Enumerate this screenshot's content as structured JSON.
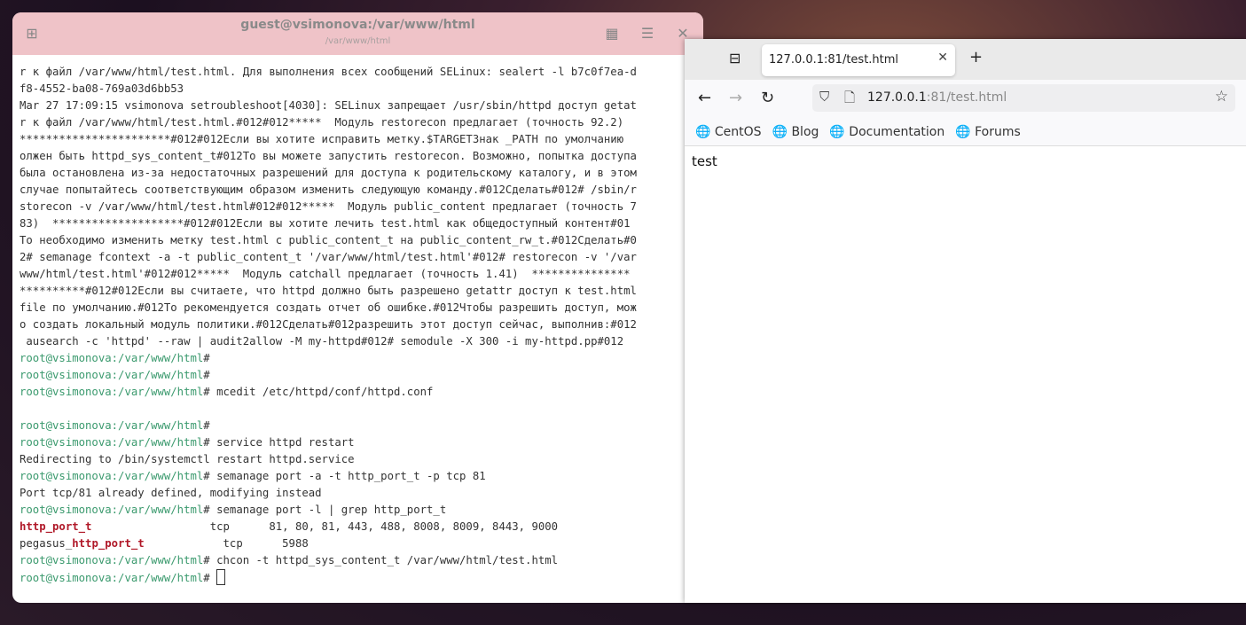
{
  "terminal": {
    "title": "guest@vsimonova:/var/www/html",
    "subtitle": "/var/www/html",
    "lines": [
      {
        "text": "r к файл /var/www/html/test.html. Для выполнения всех сообщений SELinux: sealert -l b7c0f7ea-d"
      },
      {
        "text": "f8-4552-ba08-769a03d6bb53"
      },
      {
        "text": "Mar 27 17:09:15 vsimonova setroubleshoot[4030]: SELinux запрещает /usr/sbin/httpd доступ getat"
      },
      {
        "text": "r к файл /var/www/html/test.html.#012#012*****  Модуль restorecon предлагает (точность 92.2)"
      },
      {
        "text": "***********************#012#012Если вы хотите исправить метку.$TARGETЗнак _PATH по умолчанию"
      },
      {
        "text": "олжен быть httpd_sys_content_t#012То вы можете запустить restorecon. Возможно, попытка доступа"
      },
      {
        "text": "была остановлена из-за недостаточных разрешений для доступа к родительскому каталогу, и в этом"
      },
      {
        "text": "случае попытайтесь соответствующим образом изменить следующую команду.#012Сделать#012# /sbin/r"
      },
      {
        "text": "storecon -v /var/www/html/test.html#012#012*****  Модуль public_content предлагает (точность 7"
      },
      {
        "text": "83)  ********************#012#012Если вы хотите лечить test.html как общедоступный контент#01"
      },
      {
        "text": "То необходимо изменить метку test.html с public_content_t на public_content_rw_t.#012Сделать#0"
      },
      {
        "text": "2# semanage fcontext -a -t public_content_t '/var/www/html/test.html'#012# restorecon -v '/var"
      },
      {
        "text": "www/html/test.html'#012#012*****  Модуль catchall предлагает (точность 1.41)  ***************"
      },
      {
        "text": "**********#012#012Если вы считаете, что httpd должно быть разрешено getattr доступ к test.html"
      },
      {
        "text": "file по умолчанию.#012То рекомендуется создать отчет об ошибке.#012Чтобы разрешить доступ, мож"
      },
      {
        "text": "о создать локальный модуль политики.#012Сделать#012разрешить этот доступ сейчас, выполнив:#012"
      },
      {
        "text": " ausearch -c 'httpd' --raw | audit2allow -M my-httpd#012# semodule -X 300 -i my-httpd.pp#012"
      },
      {
        "prompt": "root@vsimonova:/var/www/html",
        "text": "#"
      },
      {
        "prompt": "root@vsimonova:/var/www/html",
        "text": "#"
      },
      {
        "prompt": "root@vsimonova:/var/www/html",
        "text": "# mcedit /etc/httpd/conf/httpd.conf"
      },
      {
        "text": ""
      },
      {
        "prompt": "root@vsimonova:/var/www/html",
        "text": "#"
      },
      {
        "prompt": "root@vsimonova:/var/www/html",
        "text": "# service httpd restart"
      },
      {
        "text": "Redirecting to /bin/systemctl restart httpd.service"
      },
      {
        "prompt": "root@vsimonova:/var/www/html",
        "text": "# semanage port -a -t http_port_t -p tcp 81"
      },
      {
        "text": "Port tcp/81 already defined, modifying instead"
      },
      {
        "prompt": "root@vsimonova:/var/www/html",
        "text": "# semanage port -l | grep http_port_t"
      },
      {
        "highlight": "http_port_t",
        "text": "                  tcp      81, 80, 81, 443, 488, 8008, 8009, 8443, 9000"
      },
      {
        "pre": "pegasus_",
        "highlight": "http_port_t",
        "text": "            tcp      5988"
      },
      {
        "prompt": "root@vsimonova:/var/www/html",
        "text": "# chcon -t httpd_sys_content_t /var/www/html/test.html"
      },
      {
        "prompt": "root@vsimonova:/var/www/html",
        "text": "# ",
        "cursor": true
      }
    ]
  },
  "browser": {
    "tab_title": "127.0.0.1:81/test.html",
    "url_host": "127.0.0.1",
    "url_rest": ":81/test.html",
    "bookmarks": [
      "CentOS",
      "Blog",
      "Documentation",
      "Forums"
    ],
    "page_text": "test"
  }
}
